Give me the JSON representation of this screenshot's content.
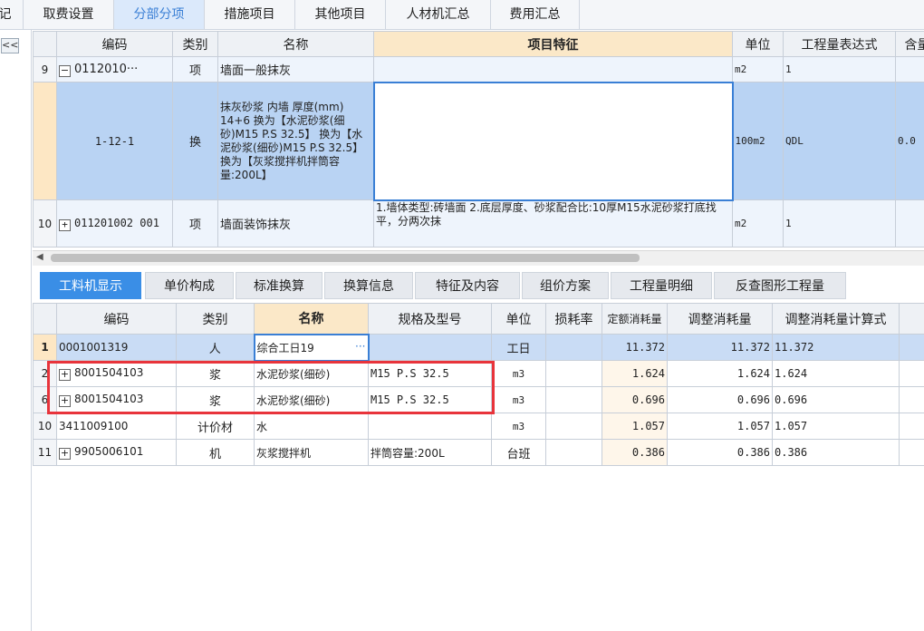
{
  "top_tabs": [
    {
      "label": "记"
    },
    {
      "label": "取费设置"
    },
    {
      "label": "分部分项"
    },
    {
      "label": "措施项目"
    },
    {
      "label": "其他项目"
    },
    {
      "label": "人材机汇总"
    },
    {
      "label": "费用汇总"
    }
  ],
  "collapse_label": "<<",
  "upper_grid": {
    "headers": [
      "编码",
      "类别",
      "名称",
      "项目特征",
      "单位",
      "工程量表达式",
      "含量"
    ],
    "rows": [
      {
        "num": "9",
        "code": "0112010···",
        "type": "项",
        "name": "墙面一般抹灰",
        "feature": "",
        "unit": "m2",
        "expr": "1",
        "content": ""
      },
      {
        "num": "",
        "code": "1-12-1",
        "type": "换",
        "name": "抹灰砂浆 内墙 厚度(mm) 14+6 换为【水泥砂浆(细砂)M15 P.S 32.5】 换为【水泥砂浆(细砂)M15 P.S 32.5】 换为【灰浆搅拌机拌筒容量:200L】",
        "feature": "",
        "unit": "100m2",
        "expr": "QDL",
        "content": "0.0"
      },
      {
        "num": "10",
        "code": "011201002 001",
        "type": "项",
        "name": "墙面装饰抹灰",
        "feature": "1.墙体类型:砖墙面 2.底层厚度、砂浆配合比:10厚M15水泥砂浆打底找平，分两次抹",
        "unit": "m2",
        "expr": "1",
        "content": ""
      }
    ]
  },
  "sub_tabs": [
    "工料机显示",
    "单价构成",
    "标准换算",
    "换算信息",
    "特征及内容",
    "组价方案",
    "工程量明细",
    "反查图形工程量"
  ],
  "lower_grid": {
    "headers": [
      "编码",
      "类别",
      "名称",
      "规格及型号",
      "单位",
      "损耗率",
      "定额消耗量",
      "调整消耗量",
      "调整消耗量计算式"
    ],
    "rows": [
      {
        "num": "1",
        "code": "0001001319",
        "type": "人",
        "name": "综合工日19",
        "spec": "",
        "unit": "工日",
        "loss": "",
        "qty": "11.372",
        "adj": "11.372",
        "formula": "11.372"
      },
      {
        "num": "2",
        "code": "8001504103",
        "type": "浆",
        "name": "水泥砂浆(细砂)",
        "spec": "M15 P.S 32.5",
        "unit": "m3",
        "loss": "",
        "qty": "1.624",
        "adj": "1.624",
        "formula": "1.624"
      },
      {
        "num": "6",
        "code": "8001504103",
        "type": "浆",
        "name": "水泥砂浆(细砂)",
        "spec": "M15 P.S 32.5",
        "unit": "m3",
        "loss": "",
        "qty": "0.696",
        "adj": "0.696",
        "formula": "0.696"
      },
      {
        "num": "10",
        "code": "3411009100",
        "type": "计价材",
        "name": "水",
        "spec": "",
        "unit": "m3",
        "loss": "",
        "qty": "1.057",
        "adj": "1.057",
        "formula": "1.057"
      },
      {
        "num": "11",
        "code": "9905006101",
        "type": "机",
        "name": "灰浆搅拌机",
        "spec": "拌筒容量:200L",
        "unit": "台班",
        "loss": "",
        "qty": "0.386",
        "adj": "0.386",
        "formula": "0.386"
      }
    ]
  },
  "accent_color": "#3a8ee6",
  "highlight_color": "#e8343b"
}
